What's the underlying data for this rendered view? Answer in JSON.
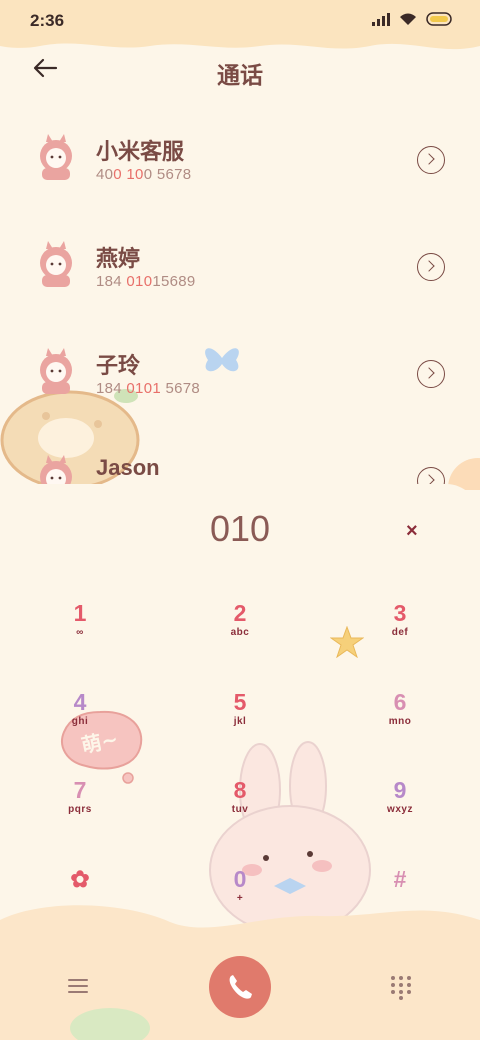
{
  "status": {
    "time": "2:36"
  },
  "header": {
    "title": "通话"
  },
  "contacts": [
    {
      "name": "小米客服",
      "num_pre": "40",
      "num_hl": "0 10",
      "num_post": "0 5678"
    },
    {
      "name": "燕婷",
      "num_pre": "184 ",
      "num_hl": "010",
      "num_post": "15689"
    },
    {
      "name": "子玲",
      "num_pre": "184 ",
      "num_hl": "0101",
      "num_post": " 5678"
    },
    {
      "name": "Jason",
      "num_pre": "",
      "num_hl": "",
      "num_post": ""
    }
  ],
  "dialer": {
    "input": "010",
    "delete_label": "×",
    "keys": [
      {
        "digit": "1",
        "letters": "∞"
      },
      {
        "digit": "2",
        "letters": "abc"
      },
      {
        "digit": "3",
        "letters": "def"
      },
      {
        "digit": "4",
        "letters": "ghi"
      },
      {
        "digit": "5",
        "letters": "jkl"
      },
      {
        "digit": "6",
        "letters": "mno"
      },
      {
        "digit": "7",
        "letters": "pqrs"
      },
      {
        "digit": "8",
        "letters": "tuv"
      },
      {
        "digit": "9",
        "letters": "wxyz"
      },
      {
        "digit": "✿",
        "letters": ""
      },
      {
        "digit": "0",
        "letters": "+"
      },
      {
        "digit": "#",
        "letters": ""
      }
    ]
  },
  "decor": {
    "bubble_text": "萌~"
  },
  "icons": {
    "back": "back-arrow-icon",
    "chevron": "chevron-right-circle-icon",
    "menu": "menu-icon",
    "call": "phone-icon",
    "dialpad": "dialpad-icon"
  },
  "colors": {
    "accent": "#e07a6c",
    "text": "#7a4b45",
    "highlight": "#e8706a",
    "bg": "#fdf6e9"
  }
}
